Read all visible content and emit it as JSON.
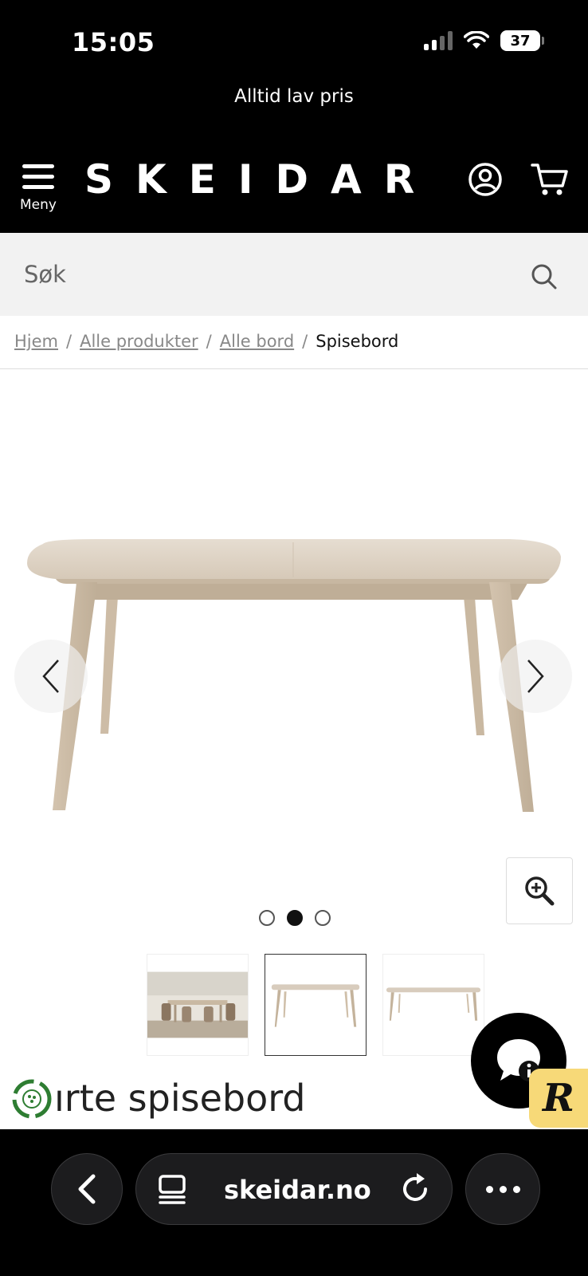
{
  "status_bar": {
    "time": "15:05",
    "battery": "37"
  },
  "promo": {
    "text": "Alltid lav pris"
  },
  "header": {
    "menu_label": "Meny",
    "logo": "SKEIDAR"
  },
  "search": {
    "placeholder": "Søk"
  },
  "breadcrumb": {
    "items": [
      "Hjem",
      "Alle produkter",
      "Alle bord"
    ],
    "separator": "/",
    "current": "Spisebord"
  },
  "gallery": {
    "dot_count": 3,
    "active_index": 1
  },
  "product": {
    "title_visible": "ırte spisebord"
  },
  "browser": {
    "url": "skeidar.no"
  },
  "colors": {
    "header_bg": "#000000",
    "search_bg": "#f2f2f2",
    "badge_yellow": "#f7d978",
    "eco_green": "#2e7d32"
  }
}
